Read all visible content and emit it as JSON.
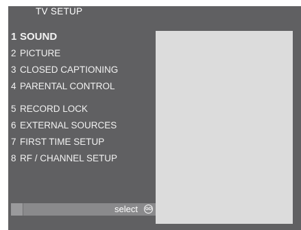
{
  "header": {
    "title": "TV  SETUP"
  },
  "menu": {
    "items": [
      {
        "number": "1",
        "label": "SOUND",
        "active": true
      },
      {
        "number": "2",
        "label": "PICTURE"
      },
      {
        "number": "3",
        "label": "CLOSED CAPTIONING"
      },
      {
        "number": "4",
        "label": "PARENTAL CONTROL"
      },
      {
        "number": "5",
        "label": "RECORD LOCK"
      },
      {
        "number": "6",
        "label": "EXTERNAL SOURCES"
      },
      {
        "number": "7",
        "label": "FIRST TIME SETUP"
      },
      {
        "number": "8",
        "label": "RF / CHANNEL SETUP"
      }
    ]
  },
  "footer": {
    "select_label": "select",
    "go_icon_text": "GO",
    "go_icon": "go-button-icon"
  },
  "colors": {
    "panel_background": "#606062",
    "preview_background": "#dcdcdc",
    "text": "#ffffff"
  }
}
